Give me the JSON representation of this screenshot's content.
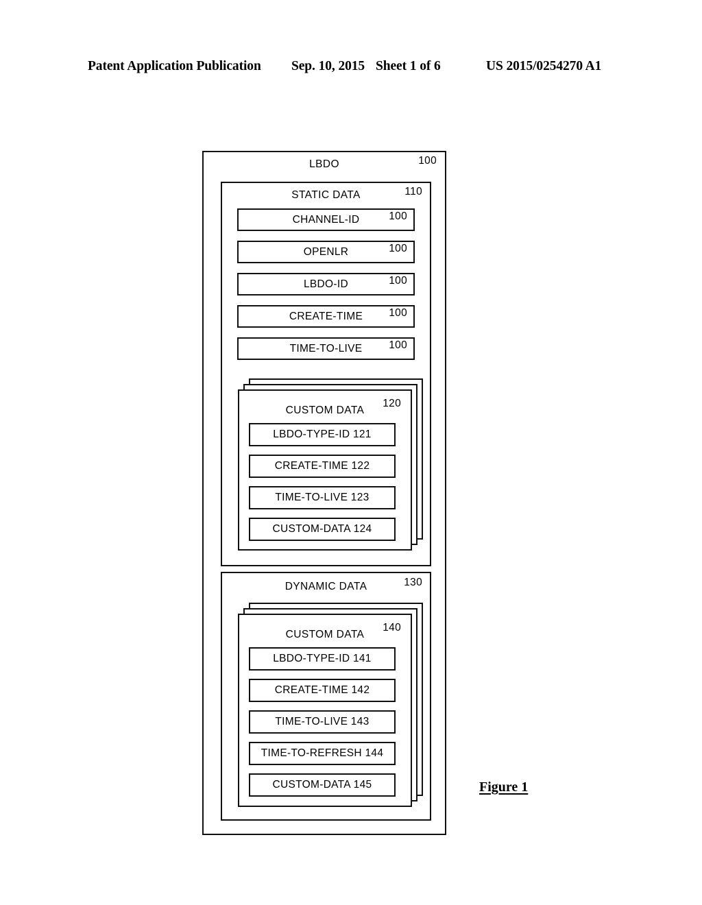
{
  "header": {
    "title": "Patent Application Publication",
    "date": "Sep. 10, 2015",
    "sheet": "Sheet 1 of 6",
    "number": "US 2015/0254270 A1"
  },
  "figure": {
    "caption": "Figure 1"
  },
  "diagram": {
    "lbdo": {
      "title": "LBDO",
      "ref": "100"
    },
    "static": {
      "title": "STATIC DATA",
      "ref": "110",
      "fields": [
        {
          "label": "CHANNEL-ID",
          "ref": "100"
        },
        {
          "label": "OPENLR",
          "ref": "100"
        },
        {
          "label": "LBDO-ID",
          "ref": "100"
        },
        {
          "label": "CREATE-TIME",
          "ref": "100"
        },
        {
          "label": "TIME-TO-LIVE",
          "ref": "100"
        }
      ],
      "custom": {
        "title": "CUSTOM DATA",
        "ref": "120",
        "fields": [
          {
            "label": "LBDO-TYPE-ID  121"
          },
          {
            "label": "CREATE-TIME  122"
          },
          {
            "label": "TIME-TO-LIVE  123"
          },
          {
            "label": "CUSTOM-DATA  124"
          }
        ]
      }
    },
    "dynamic": {
      "title": "DYNAMIC DATA",
      "ref": "130",
      "custom": {
        "title": "CUSTOM DATA",
        "ref": "140",
        "fields": [
          {
            "label": "LBDO-TYPE-ID  141"
          },
          {
            "label": "CREATE-TIME  142"
          },
          {
            "label": "TIME-TO-LIVE  143"
          },
          {
            "label": "TIME-TO-REFRESH  144"
          },
          {
            "label": "CUSTOM-DATA  145"
          }
        ]
      }
    }
  }
}
